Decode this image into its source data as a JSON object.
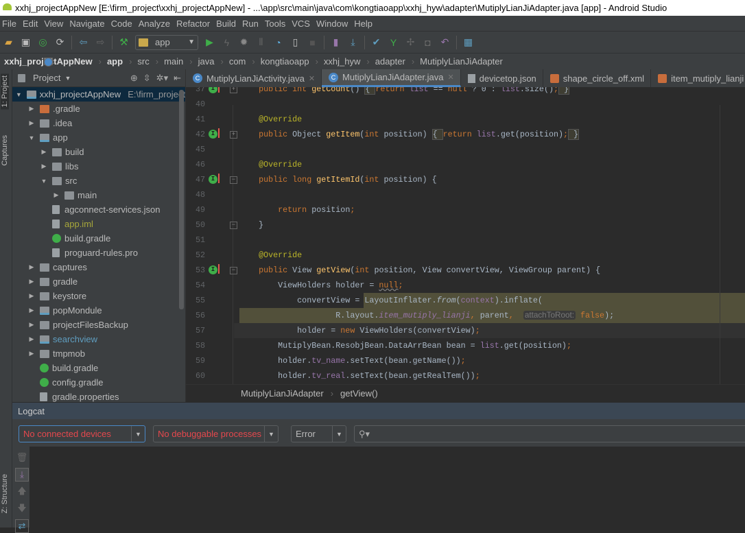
{
  "window": {
    "title": "xxhj_projectAppNew [E:\\firm_project\\xxhj_projectAppNew] - ...\\app\\src\\main\\java\\com\\kongtiaoapp\\xxhj_hyw\\adapter\\MutiplyLianJiAdapter.java [app] - Android Studio"
  },
  "menu": [
    "File",
    "Edit",
    "View",
    "Navigate",
    "Code",
    "Analyze",
    "Refactor",
    "Build",
    "Run",
    "Tools",
    "VCS",
    "Window",
    "Help"
  ],
  "toolbar": {
    "config": "app"
  },
  "breadcrumb": [
    "xxhj_projectAppNew",
    "app",
    "src",
    "main",
    "java",
    "com",
    "kongtiaoapp",
    "xxhj_hyw",
    "adapter",
    "MutiplyLianJiAdapter"
  ],
  "side_tabs": {
    "project": "1: Project",
    "captures": "Captures",
    "structure": "Z: Structure"
  },
  "project": {
    "title": "Project",
    "tree": [
      {
        "label": "xxhj_projectAppNew",
        "extra": "E:\\firm_project",
        "depth": 0,
        "open": true,
        "icon": "mod",
        "sel": true
      },
      {
        "label": ".gradle",
        "depth": 1,
        "open": false,
        "icon": "orange"
      },
      {
        "label": ".idea",
        "depth": 1,
        "open": false,
        "icon": "folder"
      },
      {
        "label": "app",
        "depth": 1,
        "open": true,
        "icon": "mod"
      },
      {
        "label": "build",
        "depth": 2,
        "open": false,
        "icon": "folder"
      },
      {
        "label": "libs",
        "depth": 2,
        "open": false,
        "icon": "folder"
      },
      {
        "label": "src",
        "depth": 2,
        "open": true,
        "icon": "folder"
      },
      {
        "label": "main",
        "depth": 3,
        "open": false,
        "icon": "folder"
      },
      {
        "label": "agconnect-services.json",
        "depth": 2,
        "icon": "file"
      },
      {
        "label": "app.iml",
        "depth": 2,
        "icon": "file",
        "color": "#a8a83b"
      },
      {
        "label": "build.gradle",
        "depth": 2,
        "icon": "gradle"
      },
      {
        "label": "proguard-rules.pro",
        "depth": 2,
        "icon": "file"
      },
      {
        "label": "captures",
        "depth": 1,
        "open": false,
        "icon": "folder"
      },
      {
        "label": "gradle",
        "depth": 1,
        "open": false,
        "icon": "folder"
      },
      {
        "label": "keystore",
        "depth": 1,
        "open": false,
        "icon": "folder"
      },
      {
        "label": "popMondule",
        "depth": 1,
        "open": false,
        "icon": "mod"
      },
      {
        "label": "projectFilesBackup",
        "depth": 1,
        "open": false,
        "icon": "folder"
      },
      {
        "label": "searchview",
        "depth": 1,
        "open": false,
        "icon": "mod",
        "color": "#5f9ec0"
      },
      {
        "label": "tmpmob",
        "depth": 1,
        "open": false,
        "icon": "folder"
      },
      {
        "label": "build.gradle",
        "depth": 1,
        "icon": "gradle"
      },
      {
        "label": "config.gradle",
        "depth": 1,
        "icon": "gradle"
      },
      {
        "label": "gradle.properties",
        "depth": 1,
        "icon": "file"
      }
    ]
  },
  "editor": {
    "tabs": [
      {
        "label": "MutiplyLianJiActivity.java",
        "icon": "c"
      },
      {
        "label": "MutiplyLianJiAdapter.java",
        "icon": "c",
        "active": true
      },
      {
        "label": "devicetop.json",
        "icon": "json"
      },
      {
        "label": "shape_circle_off.xml",
        "icon": "xml"
      },
      {
        "label": "item_mutiply_lianji",
        "icon": "xml"
      }
    ],
    "lines": [
      {
        "n": "37",
        "g": true,
        "fold": "+",
        "seg": [
          [
            "    ",
            ""
          ],
          [
            "public int ",
            "k"
          ],
          [
            "getCount",
            "f"
          ],
          [
            "() ",
            ""
          ],
          [
            "{ ",
            "fb"
          ],
          [
            "return ",
            "k"
          ],
          [
            "list ",
            "p"
          ],
          [
            "== ",
            ""
          ],
          [
            "null ",
            "k"
          ],
          [
            "? 0 : ",
            ""
          ],
          [
            "list",
            "p"
          ],
          [
            ".size()",
            ""
          ],
          [
            ";",
            "k"
          ],
          [
            " }",
            "fb"
          ]
        ]
      },
      {
        "n": "40",
        "seg": []
      },
      {
        "n": "41",
        "seg": [
          [
            "    ",
            ""
          ],
          [
            "@Override",
            "a"
          ]
        ]
      },
      {
        "n": "42",
        "g": true,
        "fold": "+",
        "seg": [
          [
            "    ",
            ""
          ],
          [
            "public ",
            "k"
          ],
          [
            "Object ",
            ""
          ],
          [
            "getItem",
            "f"
          ],
          [
            "(",
            ""
          ],
          [
            "int ",
            "k"
          ],
          [
            "position) ",
            ""
          ],
          [
            "{ ",
            "fb"
          ],
          [
            "return ",
            "k"
          ],
          [
            "list",
            "p"
          ],
          [
            ".get(position)",
            ""
          ],
          [
            ";",
            "k"
          ],
          [
            " }",
            "fb"
          ]
        ]
      },
      {
        "n": "45",
        "seg": []
      },
      {
        "n": "46",
        "seg": [
          [
            "    ",
            ""
          ],
          [
            "@Override",
            "a"
          ]
        ]
      },
      {
        "n": "47",
        "g": true,
        "fold": "-",
        "seg": [
          [
            "    ",
            ""
          ],
          [
            "public long ",
            "k"
          ],
          [
            "getItemId",
            "f"
          ],
          [
            "(",
            ""
          ],
          [
            "int ",
            "k"
          ],
          [
            "position) {",
            ""
          ]
        ]
      },
      {
        "n": "48",
        "seg": []
      },
      {
        "n": "49",
        "seg": [
          [
            "        ",
            ""
          ],
          [
            "return ",
            "k"
          ],
          [
            "position",
            ""
          ],
          [
            ";",
            "k"
          ]
        ]
      },
      {
        "n": "50",
        "fold": "-",
        "seg": [
          [
            "    }",
            ""
          ]
        ]
      },
      {
        "n": "51",
        "seg": []
      },
      {
        "n": "52",
        "seg": [
          [
            "    ",
            ""
          ],
          [
            "@Override",
            "a"
          ]
        ]
      },
      {
        "n": "53",
        "g": true,
        "fold": "-",
        "seg": [
          [
            "    ",
            ""
          ],
          [
            "public ",
            "k"
          ],
          [
            "View ",
            ""
          ],
          [
            "getView",
            "f"
          ],
          [
            "(",
            ""
          ],
          [
            "int ",
            "k"
          ],
          [
            "position, ",
            ""
          ],
          [
            "View convertView, ViewGroup parent) {",
            ""
          ]
        ]
      },
      {
        "n": "54",
        "seg": [
          [
            "        ViewHolders holder = ",
            ""
          ],
          [
            "null",
            "k nul"
          ],
          [
            ";",
            "k"
          ]
        ]
      },
      {
        "n": "55",
        "hl": "part",
        "seg": [
          [
            "            convertView = LayoutInflater.",
            ""
          ],
          [
            "from",
            "fi"
          ],
          [
            "(",
            ""
          ],
          [
            "context",
            "p"
          ],
          [
            ").inflate(",
            ""
          ]
        ]
      },
      {
        "n": "56",
        "hl": "full",
        "seg": [
          [
            "                    R.layout.",
            ""
          ],
          [
            "item_mutiply_lianji",
            "pi"
          ],
          [
            ", ",
            "k"
          ],
          [
            "parent",
            ""
          ],
          [
            ",  ",
            "k"
          ],
          [
            "attachToRoot:",
            "hint"
          ],
          [
            " false",
            "k"
          ],
          [
            ");",
            ""
          ]
        ]
      },
      {
        "n": "57",
        "caret": true,
        "seg": [
          [
            "            holder = ",
            ""
          ],
          [
            "new ",
            "k"
          ],
          [
            "ViewHolders(convertView)",
            ""
          ],
          [
            ";",
            "k"
          ]
        ]
      },
      {
        "n": "58",
        "seg": [
          [
            "        MutiplyBean.ResobjBean.DataArrBean bean = ",
            ""
          ],
          [
            "list",
            "p"
          ],
          [
            ".get(position)",
            ""
          ],
          [
            ";",
            "k"
          ]
        ]
      },
      {
        "n": "59",
        "seg": [
          [
            "        holder.",
            ""
          ],
          [
            "tv_name",
            "p"
          ],
          [
            ".setText(bean.getName())",
            ""
          ],
          [
            ";",
            "k"
          ]
        ]
      },
      {
        "n": "60",
        "seg": [
          [
            "        holder.",
            ""
          ],
          [
            "tv_real",
            "p"
          ],
          [
            ".setText(bean.getRealTem())",
            ""
          ],
          [
            ";",
            "k"
          ]
        ]
      }
    ],
    "crumb": [
      "MutiplyLianJiAdapter",
      "getView()"
    ]
  },
  "logcat": {
    "title": "Logcat",
    "device": "No connected devices",
    "process": "No debuggable processes",
    "level": "Error",
    "search_placeholder": ""
  }
}
